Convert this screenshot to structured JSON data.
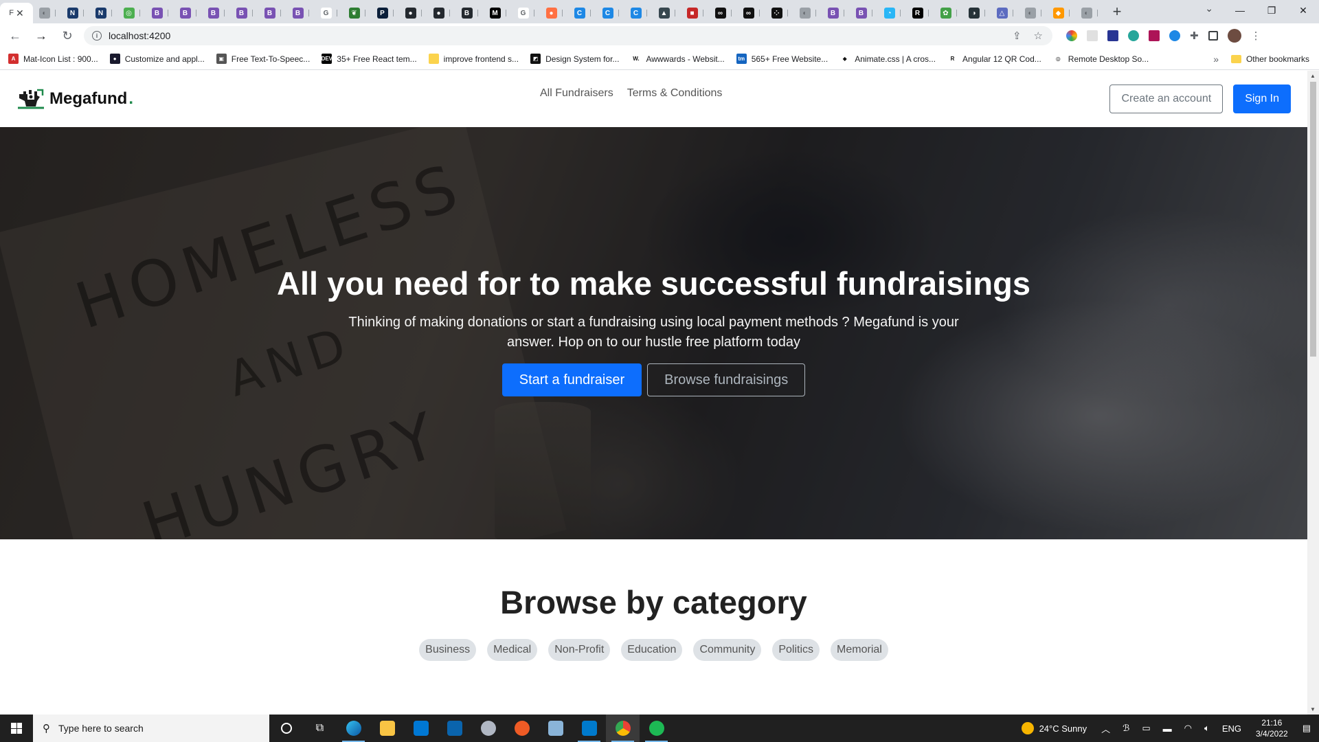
{
  "browser": {
    "active_tab_letter": "F",
    "tabs": [
      {
        "icon": "globe-icon",
        "color": "#9aa0a6",
        "glyph": "◐"
      },
      {
        "icon": "ne-icon",
        "color": "#1a3a6b",
        "glyph": "N"
      },
      {
        "icon": "ne-icon",
        "color": "#1a3a6b",
        "glyph": "N"
      },
      {
        "icon": "green-circle-icon",
        "color": "#4caf50",
        "glyph": "◎"
      },
      {
        "icon": "bootstrap-icon",
        "color": "#7952b3",
        "glyph": "B"
      },
      {
        "icon": "bootstrap-icon",
        "color": "#7952b3",
        "glyph": "B"
      },
      {
        "icon": "bootstrap-icon",
        "color": "#7952b3",
        "glyph": "B"
      },
      {
        "icon": "bootstrap-icon",
        "color": "#7952b3",
        "glyph": "B"
      },
      {
        "icon": "bootstrap-icon",
        "color": "#7952b3",
        "glyph": "B"
      },
      {
        "icon": "bootstrap-icon",
        "color": "#7952b3",
        "glyph": "B"
      },
      {
        "icon": "google-icon",
        "color": "#ffffff",
        "glyph": "G"
      },
      {
        "icon": "green-leaf-icon",
        "color": "#2e7d32",
        "glyph": "❦"
      },
      {
        "icon": "pt-icon",
        "color": "#0b1f3a",
        "glyph": "P"
      },
      {
        "icon": "github-icon",
        "color": "#24292f",
        "glyph": "●"
      },
      {
        "icon": "github-icon",
        "color": "#24292f",
        "glyph": "●"
      },
      {
        "icon": "bootstrap-icon",
        "color": "#24292f",
        "glyph": "B"
      },
      {
        "icon": "medium-icon",
        "color": "#000000",
        "glyph": "M"
      },
      {
        "icon": "google-icon",
        "color": "#ffffff",
        "glyph": "G"
      },
      {
        "icon": "colorful-icon",
        "color": "#ff7043",
        "glyph": "●"
      },
      {
        "icon": "c-icon",
        "color": "#1e88e5",
        "glyph": "C"
      },
      {
        "icon": "c-icon",
        "color": "#1e88e5",
        "glyph": "C"
      },
      {
        "icon": "c-icon",
        "color": "#1e88e5",
        "glyph": "C"
      },
      {
        "icon": "cap-icon",
        "color": "#37474f",
        "glyph": "▲"
      },
      {
        "icon": "red-icon",
        "color": "#c62828",
        "glyph": "■"
      },
      {
        "icon": "oo-icon",
        "color": "#111111",
        "glyph": "∞"
      },
      {
        "icon": "oo-icon",
        "color": "#111111",
        "glyph": "∞"
      },
      {
        "icon": "dots-icon",
        "color": "#111111",
        "glyph": "⁘"
      },
      {
        "icon": "globe-icon",
        "color": "#9aa0a6",
        "glyph": "◐"
      },
      {
        "icon": "bootstrap-icon",
        "color": "#7952b3",
        "glyph": "B"
      },
      {
        "icon": "bootstrap-icon",
        "color": "#7952b3",
        "glyph": "B"
      },
      {
        "icon": "chat-icon",
        "color": "#29b6f6",
        "glyph": "◔"
      },
      {
        "icon": "r-icon",
        "color": "#000000",
        "glyph": "R"
      },
      {
        "icon": "plant-icon",
        "color": "#43a047",
        "glyph": "✿"
      },
      {
        "icon": "edge-dark-icon",
        "color": "#263238",
        "glyph": "◑"
      },
      {
        "icon": "triangle-icon",
        "color": "#5c6bc0",
        "glyph": "△"
      },
      {
        "icon": "globe-icon",
        "color": "#9aa0a6",
        "glyph": "◐"
      },
      {
        "icon": "orange-icon",
        "color": "#ff9800",
        "glyph": "◆"
      },
      {
        "icon": "globe-icon",
        "color": "#9aa0a6",
        "glyph": "◐"
      }
    ],
    "url": "localhost:4200"
  },
  "bookmarks": [
    {
      "label": "Mat-Icon List : 900...",
      "color": "#d32f2f",
      "glyph": "A"
    },
    {
      "label": "Customize and appl...",
      "color": "#1a1a2e",
      "glyph": "●"
    },
    {
      "label": "Free Text-To-Speec...",
      "color": "#555555",
      "glyph": "▣"
    },
    {
      "label": "35+ Free React tem...",
      "color": "#000000",
      "glyph": "DEV"
    },
    {
      "label": "improve frontend s...",
      "color": "#fbd34d",
      "glyph": ""
    },
    {
      "label": "Design System for...",
      "color": "#111111",
      "glyph": "◩"
    },
    {
      "label": "Awwwards - Websit...",
      "color": "#ffffff",
      "glyph": "W."
    },
    {
      "label": "565+ Free Website...",
      "color": "#1565c0",
      "glyph": "tm"
    },
    {
      "label": "Animate.css | A cros...",
      "color": "#ffffff",
      "glyph": "◆"
    },
    {
      "label": "Angular 12 QR Cod...",
      "color": "#ffffff",
      "glyph": "R"
    },
    {
      "label": "Remote Desktop So...",
      "color": "#ffffff",
      "glyph": "◎"
    }
  ],
  "other_bookmarks": "Other bookmarks",
  "app": {
    "brand": "Megafund",
    "brand_dot": ".",
    "nav": [
      "All Fundraisers",
      "Terms & Conditions"
    ],
    "create_account": "Create an account",
    "sign_in": "Sign In"
  },
  "hero": {
    "title": "All you need for to make successful fundraisings",
    "subtitle": "Thinking of making donations or start a fundraising using local payment methods ? Megafund is your answer. Hop on to our hustle free platform today",
    "primary_cta": "Start a fundraiser",
    "secondary_cta": "Browse fundraisings",
    "sign_word_1": "HOMELESS",
    "sign_word_2": "AND",
    "sign_word_3": "HUNGRY"
  },
  "categories": {
    "title": "Browse by category",
    "items": [
      "Business",
      "Medical",
      "Non-Profit",
      "Education",
      "Community",
      "Politics",
      "Memorial"
    ]
  },
  "taskbar": {
    "search_placeholder": "Type here to search",
    "weather": "24°C  Sunny",
    "language": "ENG",
    "time": "21:16",
    "date": "3/4/2022"
  }
}
